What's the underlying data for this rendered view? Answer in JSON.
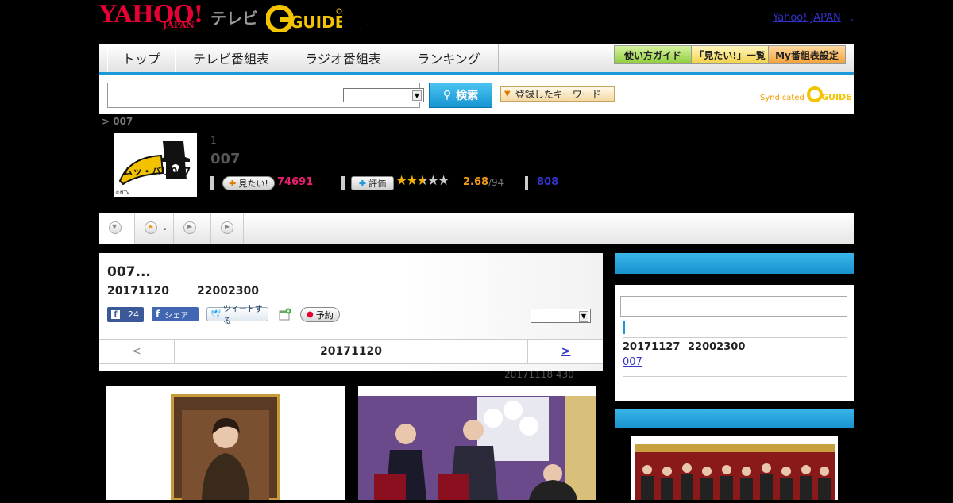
{
  "header": {
    "yahoo_logo": "YAHOO!",
    "yahoo_japan": "JAPAN",
    "tv_label": "テレビ",
    "gguide_logo": "G-GUIDE",
    "yahoo_japan_link": "Yahoo! JAPAN",
    "small_dot": ".",
    "trailing_dot": "."
  },
  "nav": {
    "tabs": [
      "トップ",
      "テレビ番組表",
      "ラジオ番組表",
      "ランキング"
    ],
    "buttons": [
      "使い方ガイド",
      "「見たい!」一覧",
      "My番組表設定"
    ]
  },
  "search": {
    "input_value": "",
    "select_value": "",
    "button_label": "検索",
    "keyword_button": "登録したキーワード",
    "syndicated": "Syndicated"
  },
  "breadcrumb": "> 007",
  "program": {
    "thumb_text": "ムッ・バリ007",
    "thumb_copyright": "©NTV",
    "episode_number": "1",
    "title": "007",
    "want_label": "見たい!",
    "want_count": "74691",
    "rate_label": "評価",
    "rating": "2.68",
    "rating_count": "/94",
    "review_count": "808",
    "stars": 2.68
  },
  "tabs": [
    {
      "icon": "chevron-down-icon",
      "label": ""
    },
    {
      "icon": "play-icon",
      "label": "."
    },
    {
      "icon": "play-icon",
      "label": ""
    },
    {
      "icon": "play-icon",
      "label": ""
    }
  ],
  "episode": {
    "title": "007...",
    "date": "20171120",
    "time": "22002300",
    "fb_count": "24",
    "share_label": "シェア",
    "tweet_label": "ツイートする",
    "reserve_label": "予約",
    "select_value": "",
    "prev_label": "<",
    "current_date": "20171120",
    "next_label": ">",
    "update_note": "20171118  430"
  },
  "sidebar": {
    "search_value": "",
    "next_date": "20171127",
    "next_time": "22002300",
    "next_link": "007"
  },
  "colors": {
    "accent": "#1a9ad6",
    "yahoo_red": "#e60033",
    "want_pink": "#e6206e",
    "rating_orange": "#f39a1b"
  }
}
